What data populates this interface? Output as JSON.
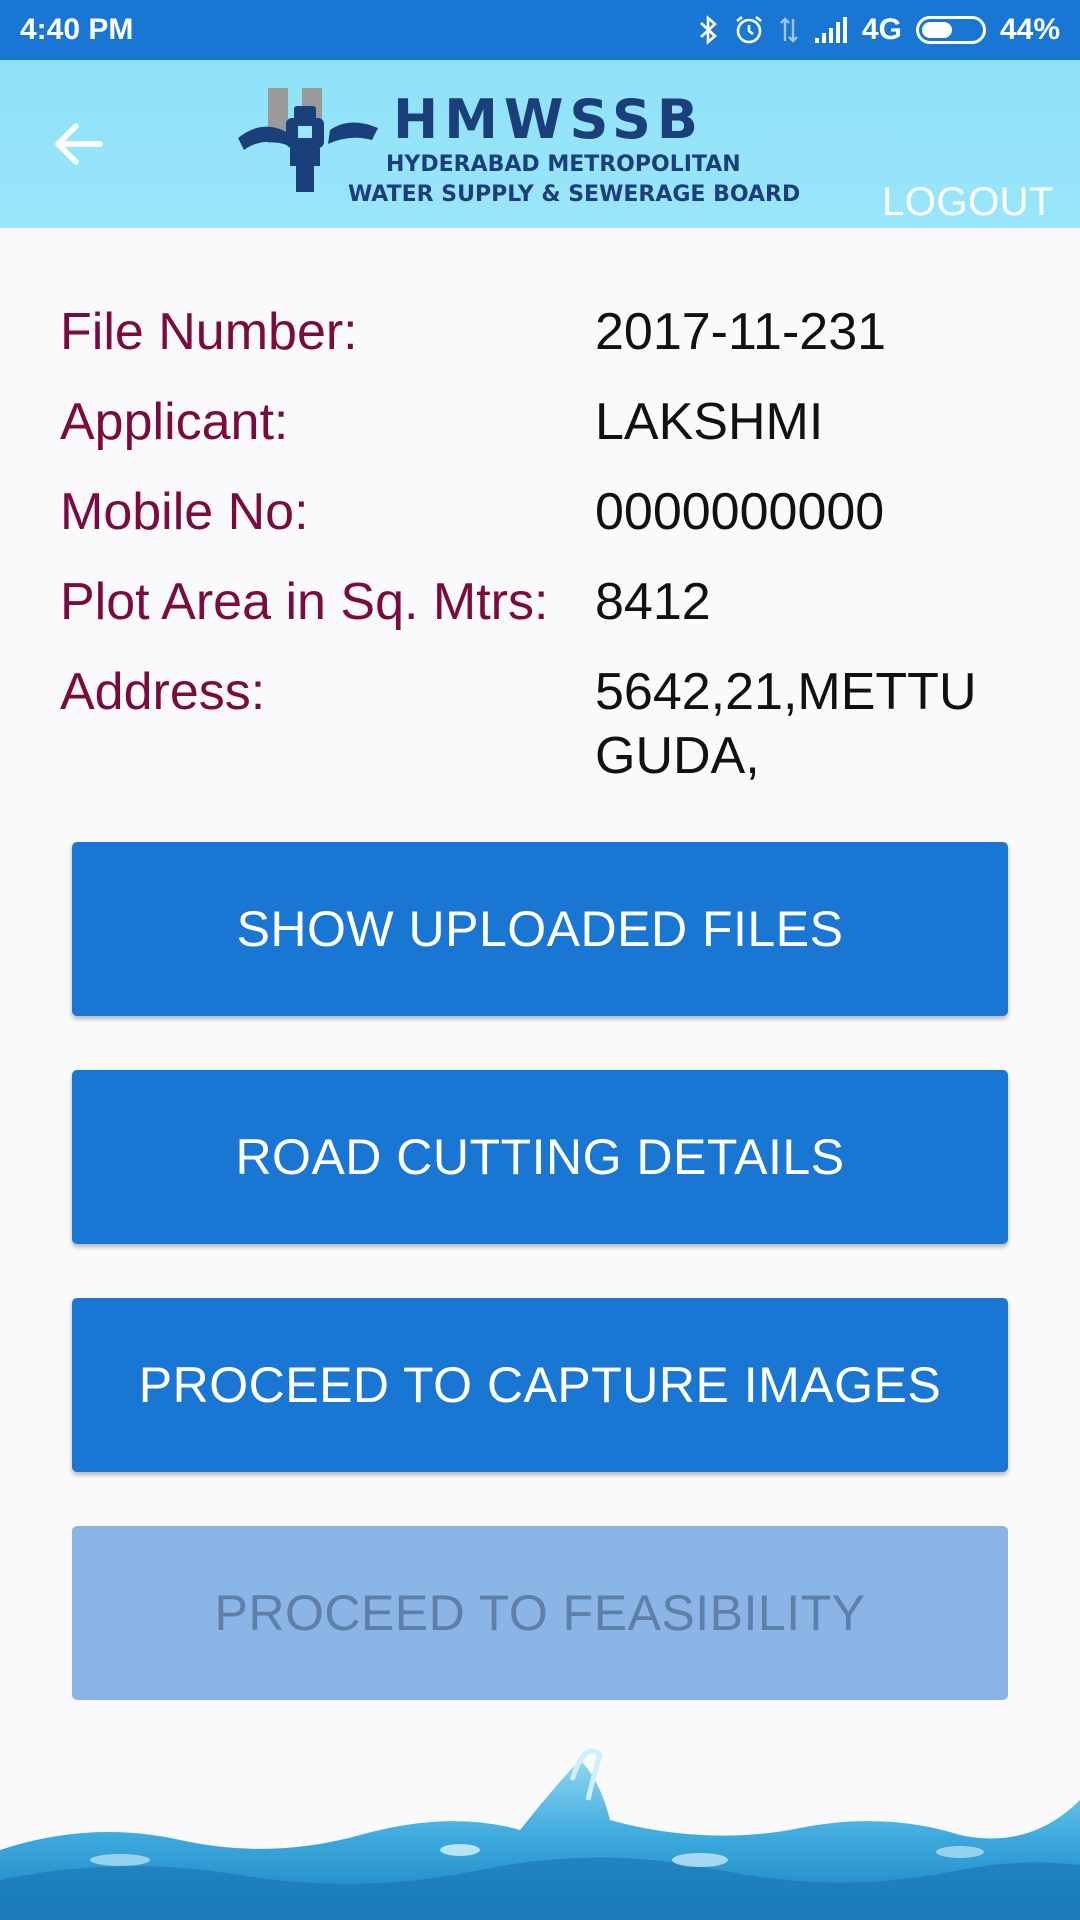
{
  "status_bar": {
    "time": "4:40 PM",
    "network": "4G",
    "battery": "44%",
    "battery_level": 0.44,
    "icons": [
      "bluetooth-icon",
      "alarm-icon",
      "data-transfer-icon",
      "signal-icon",
      "battery-icon"
    ]
  },
  "app_bar": {
    "logo": {
      "title": "HMWSSB",
      "subtitle_line1": "HYDERABAD METROPOLITAN",
      "subtitle_line2": "WATER SUPPLY & SEWERAGE BOARD"
    },
    "logout_label": "LOGOUT",
    "back_icon": "arrow-back-icon"
  },
  "details": [
    {
      "label": "File Number:",
      "value": "2017-11-231"
    },
    {
      "label": "Applicant:",
      "value": "LAKSHMI"
    },
    {
      "label": "Mobile No:",
      "value": "0000000000"
    },
    {
      "label": "Plot Area in Sq. Mtrs:",
      "value": "8412"
    },
    {
      "label": "Address:",
      "value": "5642,21,METTUGUDA,"
    }
  ],
  "buttons": {
    "show_uploaded_files": "SHOW UPLOADED FILES",
    "road_cutting_details": "ROAD CUTTING DETAILS",
    "proceed_capture_images": "PROCEED TO CAPTURE IMAGES",
    "proceed_feasibility": "PROCEED TO FEASIBILITY"
  },
  "colors": {
    "status_bar": "#1976d2",
    "app_bar": "#9ae6fb",
    "label": "#7b0a3f",
    "button": "#1976d2",
    "button_disabled": "#8bb5e6"
  }
}
